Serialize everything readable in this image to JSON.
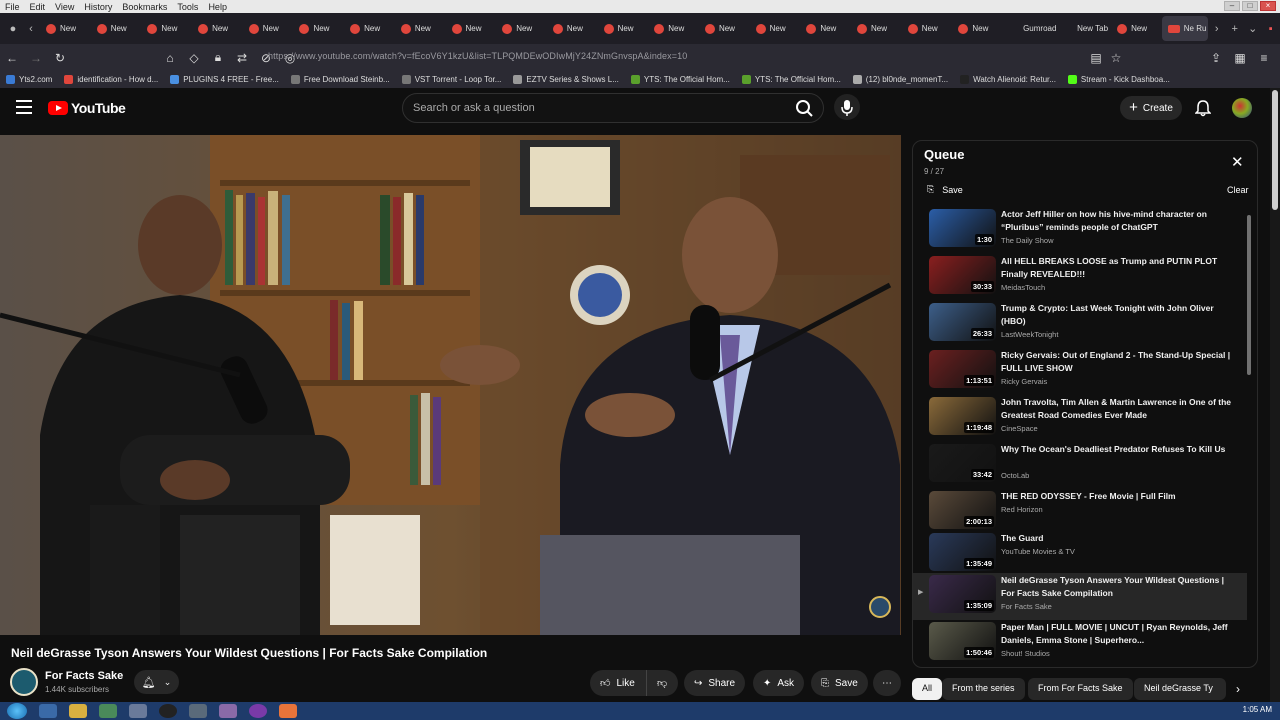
{
  "menubar": {
    "items": [
      "File",
      "Edit",
      "View",
      "History",
      "Bookmarks",
      "Tools",
      "Help"
    ]
  },
  "tabs": {
    "items": [
      "New",
      "New",
      "New",
      "New",
      "New",
      "New",
      "New",
      "New",
      "New",
      "New",
      "New",
      "New",
      "New",
      "New",
      "New",
      "New",
      "New",
      "New",
      "New",
      "Gumroad",
      "New Tab",
      "New"
    ],
    "active": "Ne Ru"
  },
  "navbar": {
    "url": "https://www.youtube.com/watch?v=fEcoV6Y1kzU&list=TLPQMDEwODIwMjY24ZNmGnvspA&index=10"
  },
  "bookmarks": [
    {
      "label": "Yts2.com",
      "color": "#3a7bd5"
    },
    {
      "label": "identification - How d...",
      "color": "#e0463c"
    },
    {
      "label": "PLUGINS 4 FREE - Free...",
      "color": "#4a90e2"
    },
    {
      "label": "Free Download Steinb...",
      "color": "#777777"
    },
    {
      "label": "VST Torrent - Loop Tor...",
      "color": "#777777"
    },
    {
      "label": "EZTV Series & Shows L...",
      "color": "#999999"
    },
    {
      "label": "YTS: The Official Hom...",
      "color": "#5aa02c"
    },
    {
      "label": "YTS: The Official Hom...",
      "color": "#5aa02c"
    },
    {
      "label": "(12) bl0nde_momenT...",
      "color": "#aaaaaa"
    },
    {
      "label": "Watch Alienoid: Retur...",
      "color": "#222222"
    },
    {
      "label": "Stream - Kick Dashboa...",
      "color": "#53fc18"
    }
  ],
  "yt": {
    "logo_text": "YouTube",
    "search_placeholder": "Search or ask a question",
    "create_label": "Create"
  },
  "video": {
    "title": "Neil deGrasse Tyson Answers Your Wildest Questions | For Facts Sake Compilation",
    "channel": "For Facts Sake",
    "subscribers": "1.44K subscribers",
    "actions": {
      "like": "Like",
      "share": "Share",
      "ask": "Ask",
      "save": "Save"
    }
  },
  "queue": {
    "title": "Queue",
    "count": "9 / 27",
    "save_label": "Save",
    "clear_label": "Clear",
    "items": [
      {
        "title": "Actor Jeff Hiller on how his hive-mind character on “Pluribus” reminds people of ChatGPT",
        "channel": "The Daily Show",
        "duration": "1:30",
        "color": "#2b5ea8"
      },
      {
        "title": "All HELL BREAKS LOOSE as Trump and PUTIN PLOT Finally REVEALED!!!",
        "channel": "MeidasTouch",
        "duration": "30:33",
        "color": "#8a1f1f"
      },
      {
        "title": "Trump & Crypto: Last Week Tonight with John Oliver (HBO)",
        "channel": "LastWeekTonight",
        "duration": "26:33",
        "color": "#3d5f8a"
      },
      {
        "title": "Ricky Gervais: Out of England 2 - The Stand-Up Special | FULL LIVE SHOW",
        "channel": "Ricky Gervais",
        "duration": "1:13:51",
        "color": "#6b2020"
      },
      {
        "title": "John Travolta, Tim Allen & Martin Lawrence in One of the Greatest Road Comedies Ever Made",
        "channel": "CineSpace",
        "duration": "1:19:48",
        "color": "#8a6a3a"
      },
      {
        "title": "Why The Ocean's Deadliest Predator Refuses To Kill Us",
        "channel": "OctoLab",
        "duration": "33:42",
        "color": "#1a1a1a"
      },
      {
        "title": "THE RED ODYSSEY - Free Movie | Full Film",
        "channel": "Red Horizon",
        "duration": "2:00:13",
        "color": "#5a4a3a"
      },
      {
        "title": "The Guard",
        "channel": "YouTube Movies & TV",
        "duration": "1:35:49",
        "color": "#2a3a5a"
      },
      {
        "title": "Neil deGrasse Tyson Answers Your Wildest Questions | For Facts Sake Compilation",
        "channel": "For Facts Sake",
        "duration": "1:35:09",
        "color": "#3a2a4a",
        "current": true
      },
      {
        "title": "Paper Man | FULL MOVIE | UNCUT | Ryan Reynolds, Jeff Daniels, Emma Stone | Superhero...",
        "channel": "Shout! Studios",
        "duration": "1:50:46",
        "color": "#5a5a4a"
      }
    ]
  },
  "chips": [
    "All",
    "From the series",
    "From For Facts Sake",
    "Neil deGrasse Ty"
  ],
  "taskbar": {
    "clock": "1:05 AM"
  }
}
